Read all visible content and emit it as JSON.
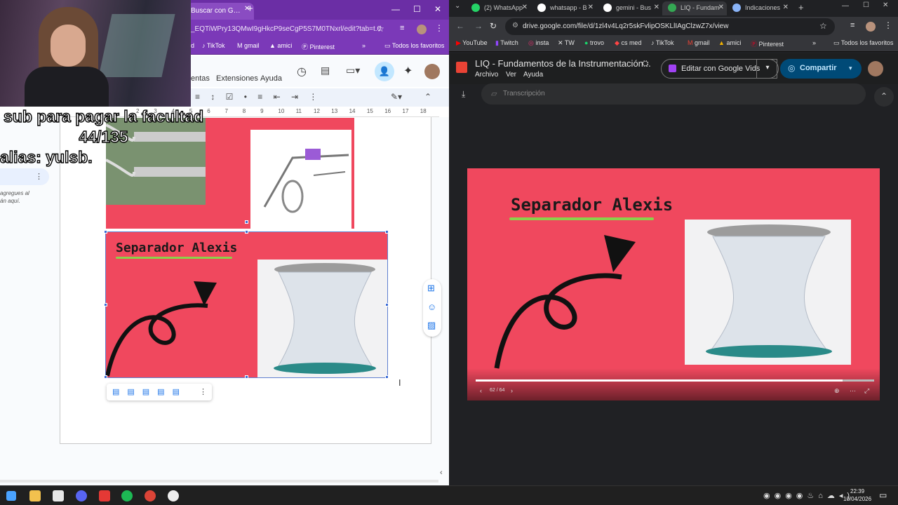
{
  "left_window": {
    "tab_title": "Buscar con G…",
    "url": "_EQTiWPry13QMwI9gHkcP9seCgP5S7M0TNxrl/edit?tab=t.0",
    "bookmarks": [
      "d",
      "TikTok",
      "gmail",
      "amici",
      "Pinterest"
    ],
    "bookmarks_folder": "Todos los favoritos",
    "menu": {
      "tools": "entas",
      "extensions": "Extensiones",
      "help": "Ayuda"
    },
    "ruler_marks": [
      "2",
      "3",
      "4",
      "5",
      "6",
      "7",
      "8",
      "9",
      "10",
      "11",
      "12",
      "13",
      "14",
      "15",
      "16",
      "17",
      "18"
    ],
    "side_panel_text": "agregues al\nán aquí.",
    "slide_title": "Separador Alexis",
    "stream_overlay": {
      "line1": "sub para pagar la facultad",
      "line2": "44/135",
      "line3": "alias: yulsb."
    }
  },
  "right_window": {
    "tabs": [
      {
        "label": "(2) WhatsApp",
        "icon": "whatsapp-icon",
        "color": "#25d366"
      },
      {
        "label": "whatsapp - B",
        "icon": "google-icon",
        "color": "#ffffff"
      },
      {
        "label": "gemini - Bus",
        "icon": "google-icon",
        "color": "#ffffff"
      },
      {
        "label": "LIQ - Fundam",
        "icon": "drive-icon",
        "color": "#34a853"
      },
      {
        "label": "Indicaciones",
        "icon": "gemini-icon",
        "color": "#8ab4f8"
      }
    ],
    "url": "drive.google.com/file/d/1zl4v4Lq2r5skFvlipOSKLlIAgClzwZ7x/view",
    "bookmarks": [
      "YouTube",
      "Twitch",
      "insta",
      "TW",
      "trovo",
      "cs med",
      "TikTok",
      "gmail",
      "amici",
      "Pinterest"
    ],
    "bookmarks_folder": "Todos los favoritos",
    "doc_title": "LIQ - Fundamentos de la Instrumentación...",
    "doc_menu": [
      "Archivo",
      "Ver",
      "Ayuda"
    ],
    "edit_button": "Editar con Google Vids",
    "share_button": "Compartir",
    "transcript_label": "Transcripción",
    "slide_title": "Separador Alexis",
    "page_counter": "62 / 64",
    "progress": 0.92
  },
  "taskbar": {
    "time": "22:39",
    "date": "10/04/2026"
  },
  "colors": {
    "slide_red": "#f0485e",
    "purple": "#7b39b8",
    "dark": "#202124"
  }
}
